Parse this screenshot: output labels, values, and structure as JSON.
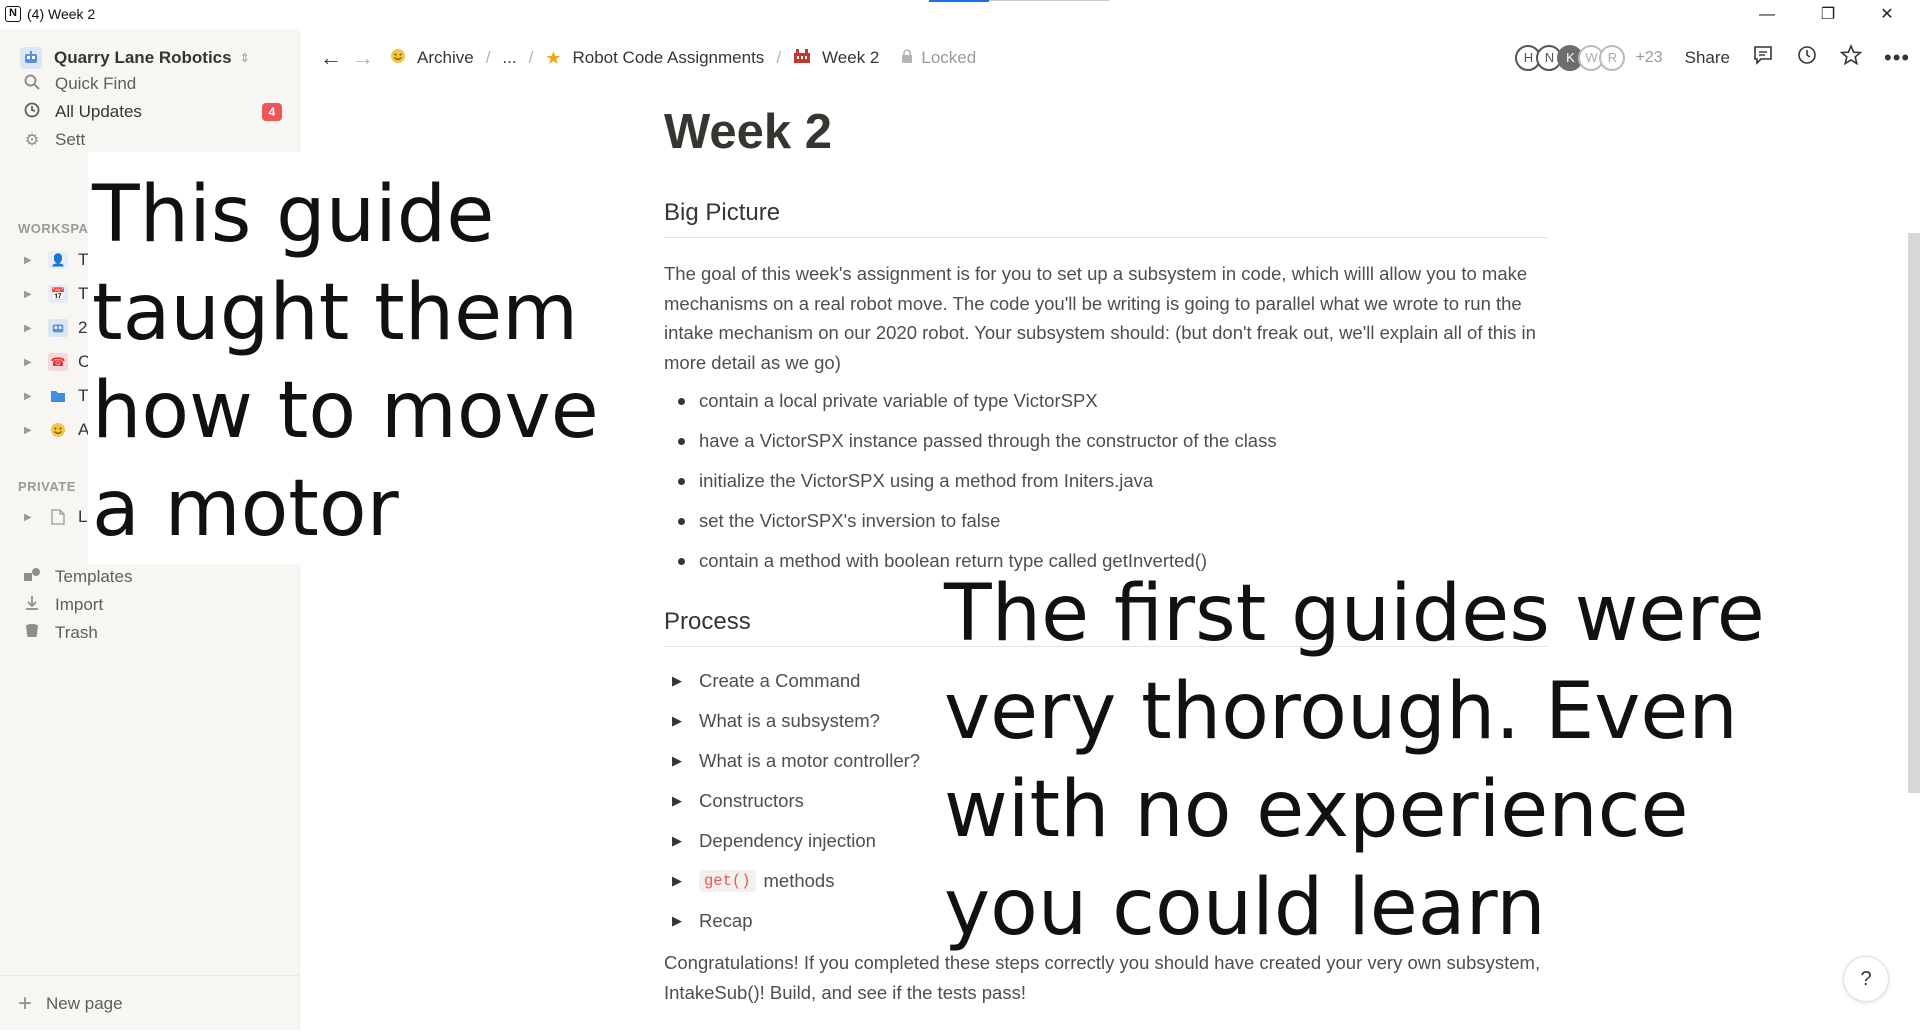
{
  "window": {
    "title": "(4) Week 2",
    "app_icon": "N",
    "controls": {
      "minimize": "—",
      "maximize": "❐",
      "close": "✕"
    }
  },
  "sidebar": {
    "workspace_name": "Quarry Lane Robotics",
    "quick_find": "Quick Find",
    "all_updates": "All Updates",
    "all_updates_badge": "4",
    "settings": "Sett",
    "workspace_label": "WORKSPA",
    "workspace_items": [
      {
        "icon": "person-icon",
        "label": "T"
      },
      {
        "icon": "calendar-icon",
        "label": "T"
      },
      {
        "icon": "robot-icon",
        "label": "2"
      },
      {
        "icon": "phone-icon",
        "label": "C"
      },
      {
        "icon": "folder-icon",
        "label": "T"
      },
      {
        "icon": "smile-icon",
        "label": "A"
      }
    ],
    "private_label": "PRIVATE",
    "private_items": [
      {
        "icon": "page-icon",
        "label": "L"
      }
    ],
    "templates": "Templates",
    "import": "Import",
    "trash": "Trash",
    "new_page": "New page"
  },
  "topbar": {
    "breadcrumbs": [
      {
        "icon": "smile-icon",
        "label": "Archive"
      },
      {
        "icon": "",
        "label": "..."
      },
      {
        "icon": "star-icon",
        "label": "Robot Code Assignments"
      },
      {
        "icon": "building-icon",
        "label": "Week 2"
      }
    ],
    "locked": "Locked",
    "avatars": [
      "H",
      "N",
      "K",
      "W",
      "R"
    ],
    "more_count": "+23",
    "share": "Share"
  },
  "page": {
    "title": "Week 2",
    "big_picture_heading": "Big Picture",
    "intro": "The goal of this week's assignment is for you to set up a subsystem in code, which willl allow you to make mechanisms on a real robot move. The code you'll be writing is going to parallel what we wrote to run the intake mechanism on our 2020 robot. Your subsystem should: (but don't freak out, we'll explain all of this in more detail as we go)",
    "bullets": [
      "contain a local private variable of type VictorSPX",
      "have a VictorSPX instance passed through the constructor of the class",
      "initialize the VictorSPX using a method from Initers.java",
      "set the VictorSPX's inversion to false",
      "contain a method with boolean return type called getInverted()"
    ],
    "process_heading": "Process",
    "toggles": [
      "Create a Command",
      "What is a subsystem?",
      "What is a motor controller?",
      "Constructors",
      "Dependency injection"
    ],
    "get_code": "get()",
    "get_methods_suffix": "methods",
    "recap": "Recap",
    "conclusion": "Congratulations! If you completed these steps correctly you should have created your very own subsystem, IntakeSub()! Build, and see if the tests pass!"
  },
  "overlays": {
    "left_caption": "This guide taught them how to move a motor",
    "right_caption": "The first guides were very thorough. Even with no experience you could learn"
  },
  "help": "?",
  "colors": {
    "sidebar_bg": "#f7f6f3",
    "badge": "#eb5757",
    "code_text": "#eb5757",
    "text": "#37352f",
    "accent": "#1a73e8"
  }
}
